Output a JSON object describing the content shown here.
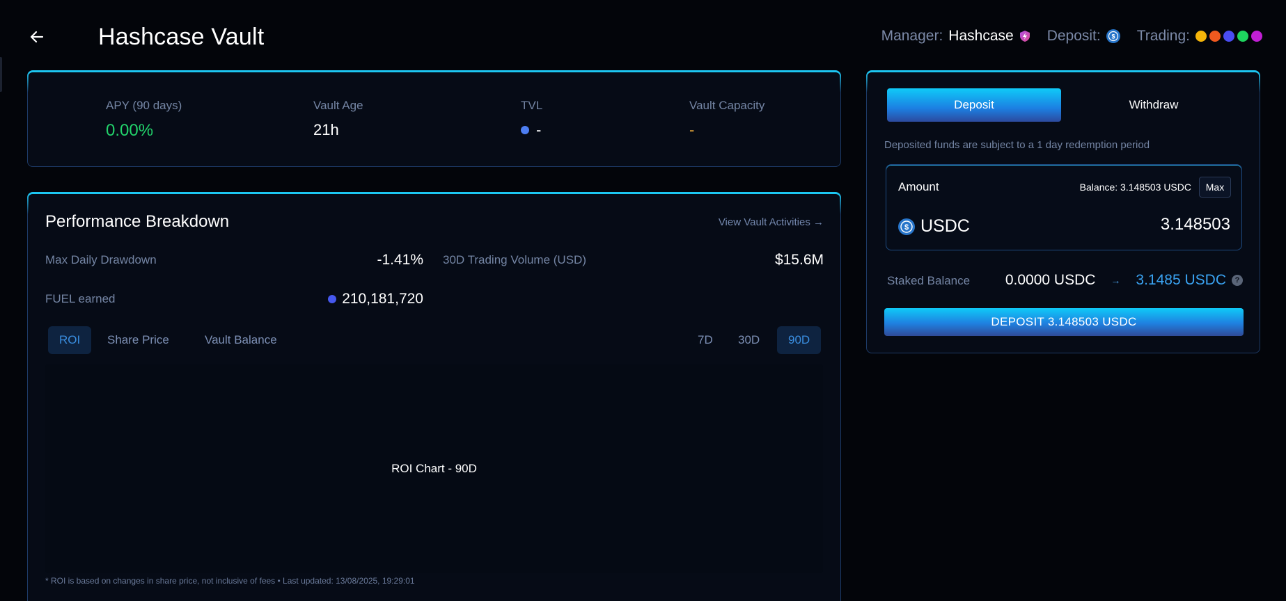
{
  "header": {
    "title": "Hashcase Vault",
    "manager_label": "Manager:",
    "manager_name": "Hashcase",
    "deposit_label": "Deposit:",
    "trading_label": "Trading:",
    "trading_colors": [
      "#f5b50a",
      "#f0591f",
      "#4a4df2",
      "#1ed65f",
      "#c21fd6"
    ]
  },
  "stats": {
    "apy_label": "APY (90 days)",
    "apy_value": "0.00%",
    "age_label": "Vault Age",
    "age_value": "21h",
    "tvl_label": "TVL",
    "tvl_value": "-",
    "capacity_label": "Vault Capacity",
    "capacity_value": "-"
  },
  "performance": {
    "title": "Performance Breakdown",
    "view_link": "View Vault Activities →",
    "max_drawdown_label": "Max Daily Drawdown",
    "max_drawdown_value": "-1.41%",
    "volume_label": "30D Trading Volume (USD)",
    "volume_value": "$15.6M",
    "fuel_label": "FUEL earned",
    "fuel_value": "210,181,720",
    "tabs": [
      "ROI",
      "Share Price",
      "Vault Balance"
    ],
    "active_tab": "ROI",
    "ranges": [
      "7D",
      "30D",
      "90D"
    ],
    "active_range": "90D",
    "chart_placeholder": "ROI Chart - 90D",
    "footnote": "* ROI is based on changes in share price, not inclusive of fees  • Last updated: 13/08/2025, 19:29:01"
  },
  "deposit_panel": {
    "deposit_tab": "Deposit",
    "withdraw_tab": "Withdraw",
    "active_tab": "Deposit",
    "redemption_note": "Deposited funds are subject to a 1 day redemption period",
    "amount_label": "Amount",
    "balance_text": "Balance: 3.148503 USDC",
    "max_label": "Max",
    "token": "USDC",
    "amount_value": "3.148503",
    "staked_label": "Staked Balance",
    "staked_current": "0.0000 USDC",
    "staked_arrow": "→",
    "staked_new": "3.1485 USDC",
    "help_glyph": "?",
    "cta_label": "DEPOSIT 3.148503 USDC"
  },
  "colors": {
    "accent_cyan": "#18c6f0",
    "apy_green": "#22d36b",
    "capacity_orange": "#e0a23a",
    "staked_blue": "#3aa3f2"
  },
  "icons": {
    "back": "arrow-left-icon",
    "manager_badge": "shield-badge-icon",
    "deposit_token": "usdc-icon",
    "help": "help-icon"
  }
}
